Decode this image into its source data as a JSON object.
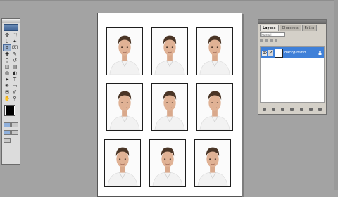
{
  "layers_panel": {
    "tabs": [
      {
        "label": "Layers",
        "active": true
      },
      {
        "label": "Channels",
        "active": false
      },
      {
        "label": "Paths",
        "active": false
      }
    ],
    "blend_mode": "Normal",
    "layer": {
      "name": "Background",
      "visible": true,
      "locked": true
    }
  },
  "colors": {
    "foreground": "#000000",
    "background": "#ffffff",
    "layer_highlight": "#3f80d8"
  },
  "tools": [
    "move-tool",
    "marquee-tool",
    "lasso-tool",
    "magic-wand-tool",
    "crop-tool",
    "slice-tool",
    "healing-brush-tool",
    "brush-tool",
    "clone-stamp-tool",
    "history-brush-tool",
    "eraser-tool",
    "gradient-tool",
    "blur-tool",
    "dodge-tool",
    "path-selection-tool",
    "type-tool",
    "pen-tool",
    "shape-tool",
    "notes-tool",
    "eyedropper-tool",
    "hand-tool",
    "zoom-tool"
  ],
  "photos_count": 9
}
